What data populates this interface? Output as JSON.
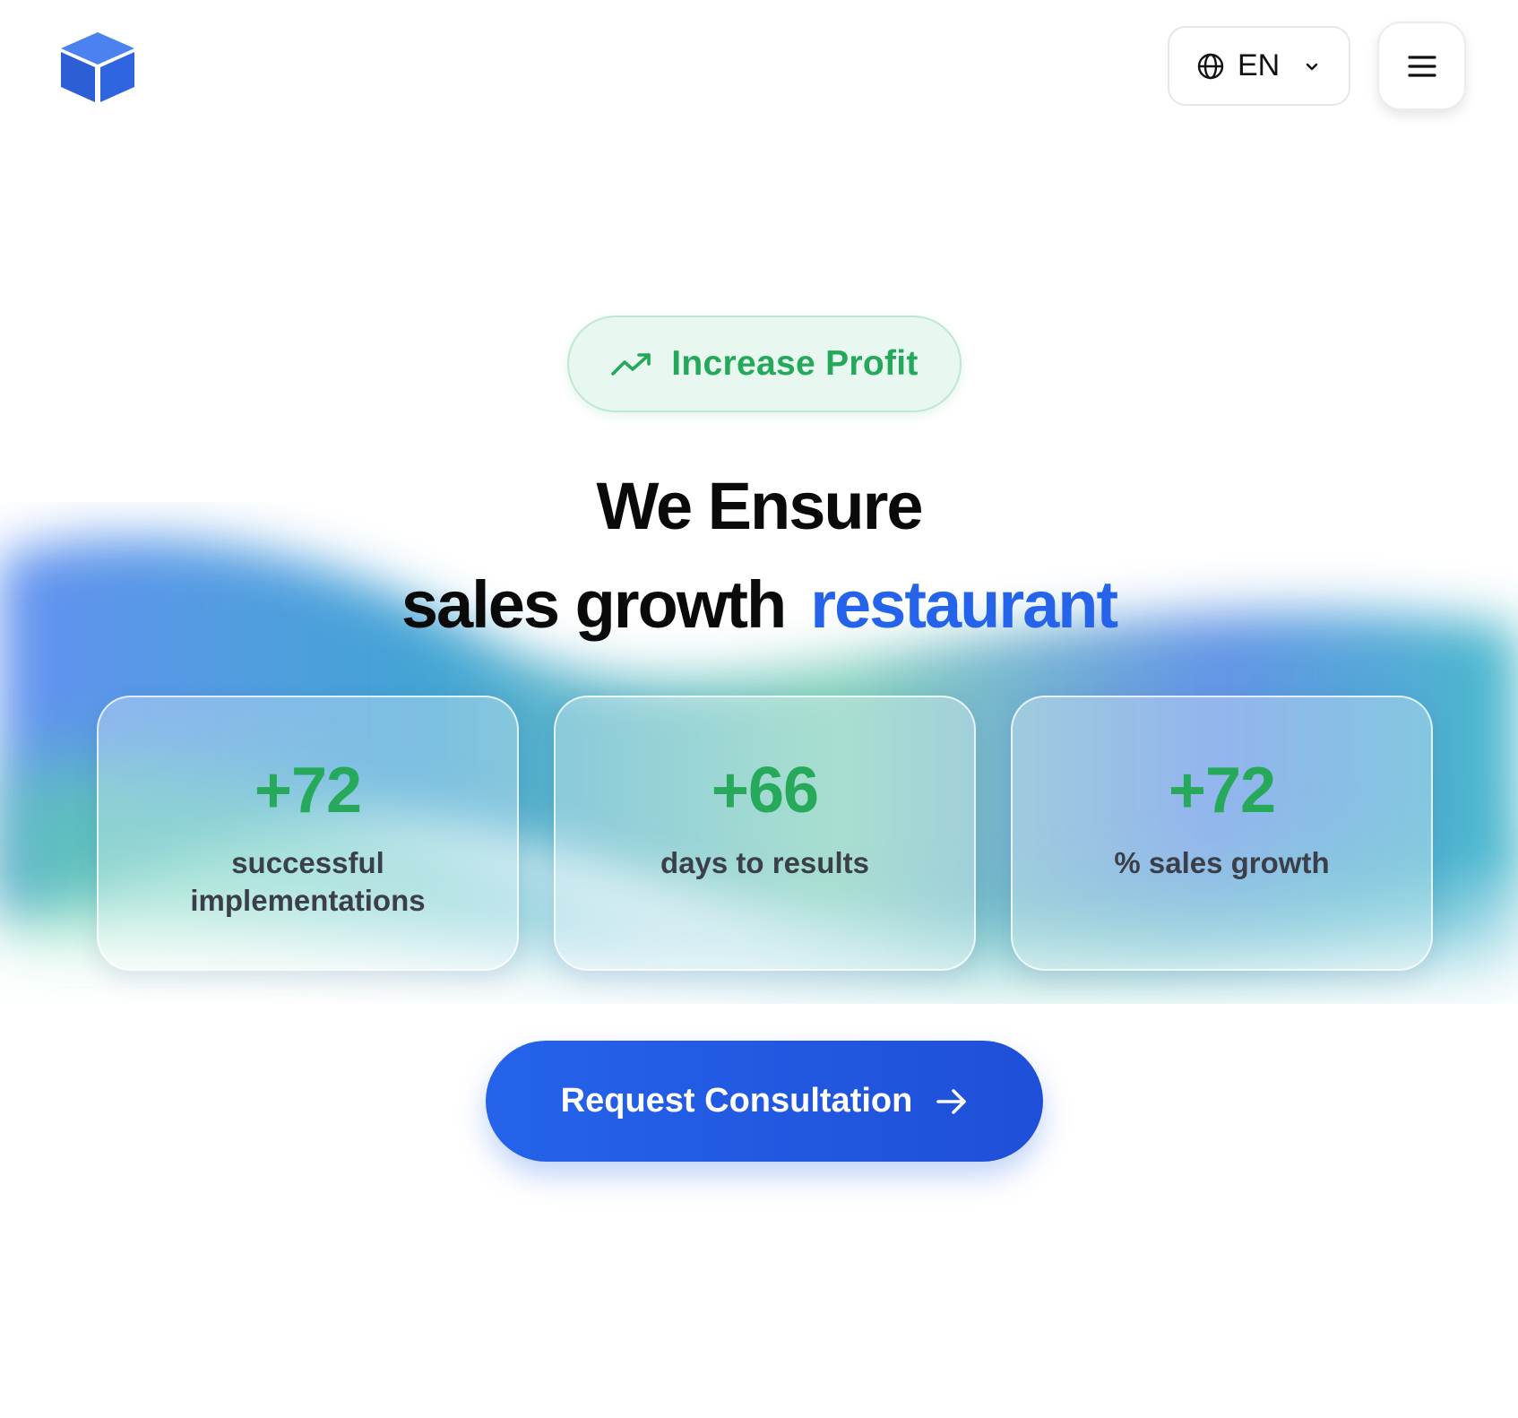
{
  "header": {
    "logo_icon": "cube-icon",
    "language": {
      "label": "EN",
      "icon": "globe-icon",
      "chevron": "chevron-down-icon"
    },
    "menu_icon": "hamburger-icon"
  },
  "hero": {
    "badge": {
      "label": "Increase Profit",
      "icon": "trending-up-icon"
    },
    "heading_line1": "We Ensure",
    "heading_line2_main": "sales growth",
    "heading_line2_accent": "restaurant"
  },
  "stats": [
    {
      "value": "+72",
      "label": "successful implementations"
    },
    {
      "value": "+66",
      "label": "days to results"
    },
    {
      "value": "+72",
      "label": "% sales growth"
    }
  ],
  "cta": {
    "label": "Request Consultation",
    "icon": "arrow-right-icon"
  },
  "colors": {
    "brand_blue": "#2563eb",
    "accent_green": "#27a95b",
    "badge_bg": "#e8f7ef",
    "text_dark": "#0a0a0a",
    "text_muted": "#3b3f49"
  }
}
